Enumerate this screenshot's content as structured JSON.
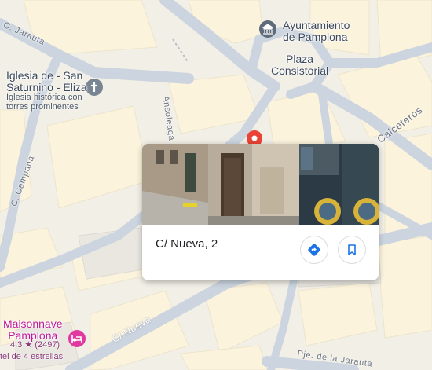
{
  "map": {
    "pois": {
      "ayuntamiento": "Ayuntamiento\nde Pamplona",
      "plaza": "Plaza\nConsistorial",
      "iglesia_name": "Iglesia de - San\nSaturnino - Eliza",
      "iglesia_desc": "Iglesia histórica con\ntorres prominentes"
    },
    "streets": {
      "jarauta": "C. Jarauta",
      "campana": "C. Campana",
      "ansoleaga": "Ansoleaga",
      "calceteros": "Calceteros",
      "nueva": "C/ Nueva",
      "jarauta_bottom": "Pje. de la Jarauta"
    },
    "hotel": {
      "name": "Maisonnave\nPamplona",
      "rating": "4.3",
      "star": "★",
      "reviews": "(2497)",
      "category": "tel de 4 estrellas"
    },
    "colors": {
      "road": "#ccd5df",
      "building": "#fbf3dc",
      "background": "#f3f1ea",
      "pin": "#ea4335",
      "hotel": "#e0399f",
      "accent": "#1a73e8"
    }
  },
  "card": {
    "title": "C/ Nueva, 2",
    "directions_icon": "directions-icon",
    "save_icon": "bookmark-icon"
  }
}
